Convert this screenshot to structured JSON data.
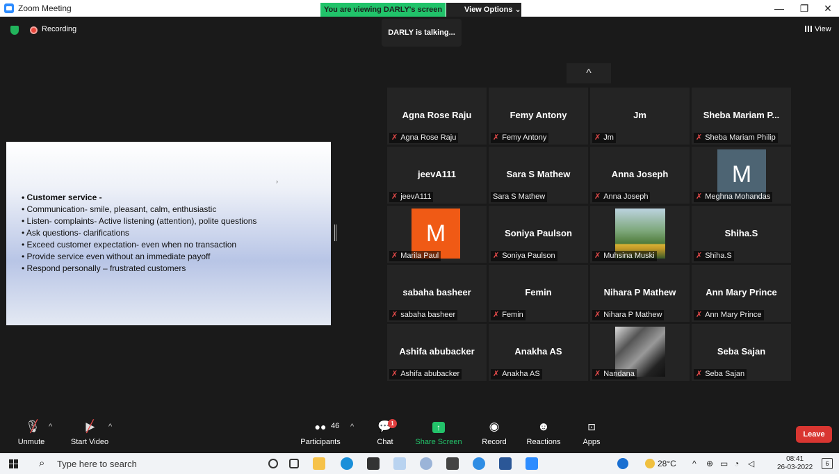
{
  "window": {
    "title": "Zoom Meeting",
    "viewing_banner": "You are viewing DARLY's screen",
    "view_options": "View Options",
    "minimize": "—",
    "maximize": "❐",
    "close": "✕"
  },
  "meeting": {
    "recording_label": "Recording",
    "talking": "DARLY is talking...",
    "view_label": "View"
  },
  "slide": {
    "bullets": [
      "Customer service -",
      "Communication- smile, pleasant, calm, enthusiastic",
      "Listen- complaints- Active listening (attention), polite questions",
      "Ask questions- clarifications",
      "Exceed customer expectation- even when no transaction",
      "Provide service even without an immediate payoff",
      "Respond personally – frustrated customers"
    ]
  },
  "gallery": {
    "participants": [
      {
        "name": "Agna Rose Raju",
        "label": "Agna Rose Raju",
        "muted": true
      },
      {
        "name": "Femy Antony",
        "label": "Femy Antony",
        "muted": true
      },
      {
        "name": "Jm",
        "label": "Jm",
        "muted": true
      },
      {
        "name": "Sheba Mariam P...",
        "label": "Sheba Mariam Philip",
        "muted": true
      },
      {
        "name": "jeevA111",
        "label": "jeevA111",
        "muted": true
      },
      {
        "name": "Sara S Mathew",
        "label": "Sara S Mathew",
        "muted": false
      },
      {
        "name": "Anna Joseph",
        "label": "Anna Joseph",
        "muted": true
      },
      {
        "name": "M",
        "label": "Meghna Mohandas",
        "muted": true
      },
      {
        "name": "M",
        "label": "Marila Paul",
        "muted": true
      },
      {
        "name": "Soniya Paulson",
        "label": "Soniya Paulson",
        "muted": true
      },
      {
        "name": "",
        "label": "Muhsina Muski",
        "muted": true
      },
      {
        "name": "Shiha.S",
        "label": "Shiha.S",
        "muted": true
      },
      {
        "name": "sabaha basheer",
        "label": "sabaha basheer",
        "muted": true
      },
      {
        "name": "Femin",
        "label": "Femin",
        "muted": true
      },
      {
        "name": "Nihara P Mathew",
        "label": "Nihara P Mathew",
        "muted": true
      },
      {
        "name": "Ann Mary Prince",
        "label": "Ann Mary Prince",
        "muted": true
      },
      {
        "name": "Ashifa abubacker",
        "label": "Ashifa abubacker",
        "muted": true
      },
      {
        "name": "Anakha AS",
        "label": "Anakha AS",
        "muted": true
      },
      {
        "name": "",
        "label": "Nandana",
        "muted": true
      },
      {
        "name": "Seba Sajan",
        "label": "Seba Sajan",
        "muted": true
      }
    ],
    "scroll_up": "^"
  },
  "toolbar": {
    "unmute": "Unmute",
    "start_video": "Start Video",
    "participants": "Participants",
    "participant_count": "46",
    "chat": "Chat",
    "chat_badge": "1",
    "share_screen": "Share Screen",
    "record": "Record",
    "reactions": "Reactions",
    "apps": "Apps",
    "leave": "Leave"
  },
  "taskbar": {
    "search_placeholder": "Type here to search",
    "temperature": "28°C",
    "time": "08:41",
    "date": "26-03-2022",
    "notifications": "6"
  }
}
